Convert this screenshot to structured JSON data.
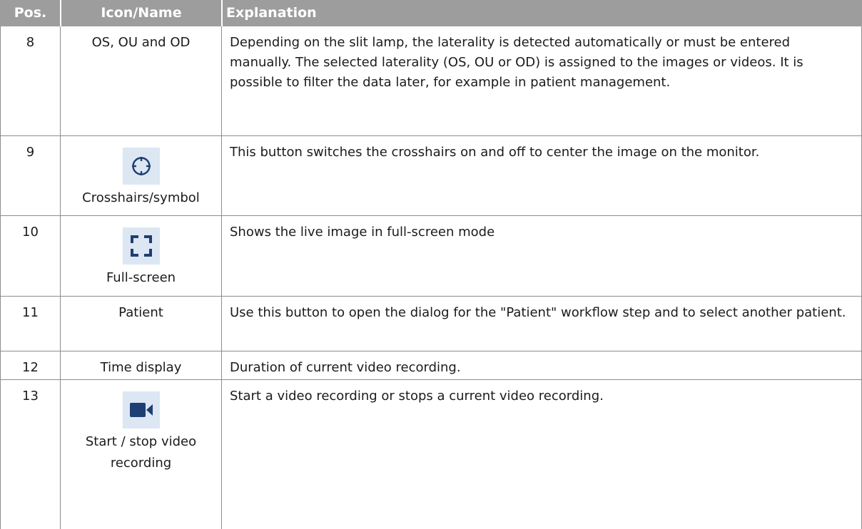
{
  "table": {
    "headers": {
      "pos": "Pos.",
      "icon_name": "Icon/Name",
      "explanation": "Explanation"
    },
    "rows": [
      {
        "pos": "8",
        "name": "OS, OU and OD",
        "icon": null,
        "explanation": "Depending on the slit lamp, the laterality is detected automatically or must be entered manually. The selected laterality (OS, OU or OD) is assigned to the images or videos. It is possible to filter the data later, for example in patient management."
      },
      {
        "pos": "9",
        "name": "Crosshairs/symbol",
        "icon": "crosshairs-icon",
        "explanation": "This button switches the crosshairs on and off to center the image on the monitor."
      },
      {
        "pos": "10",
        "name": "Full-screen",
        "icon": "fullscreen-icon",
        "explanation": "Shows the live image in full-screen mode"
      },
      {
        "pos": "11",
        "name": "Patient",
        "icon": null,
        "explanation": "Use this button to open the dialog for the \"Patient\" workflow step and to select another patient."
      },
      {
        "pos": "12",
        "name": "Time display",
        "icon": null,
        "explanation": "Duration of current video recording."
      },
      {
        "pos": "13",
        "name": "Start / stop video recording",
        "icon": "video-camera-icon",
        "explanation": "Start a video recording or stops a current video recording."
      }
    ]
  },
  "colors": {
    "header_bg": "#9d9d9d",
    "icon_bg": "#dce7f3",
    "icon_fg": "#1e3f73",
    "border": "#8c8c8c"
  }
}
